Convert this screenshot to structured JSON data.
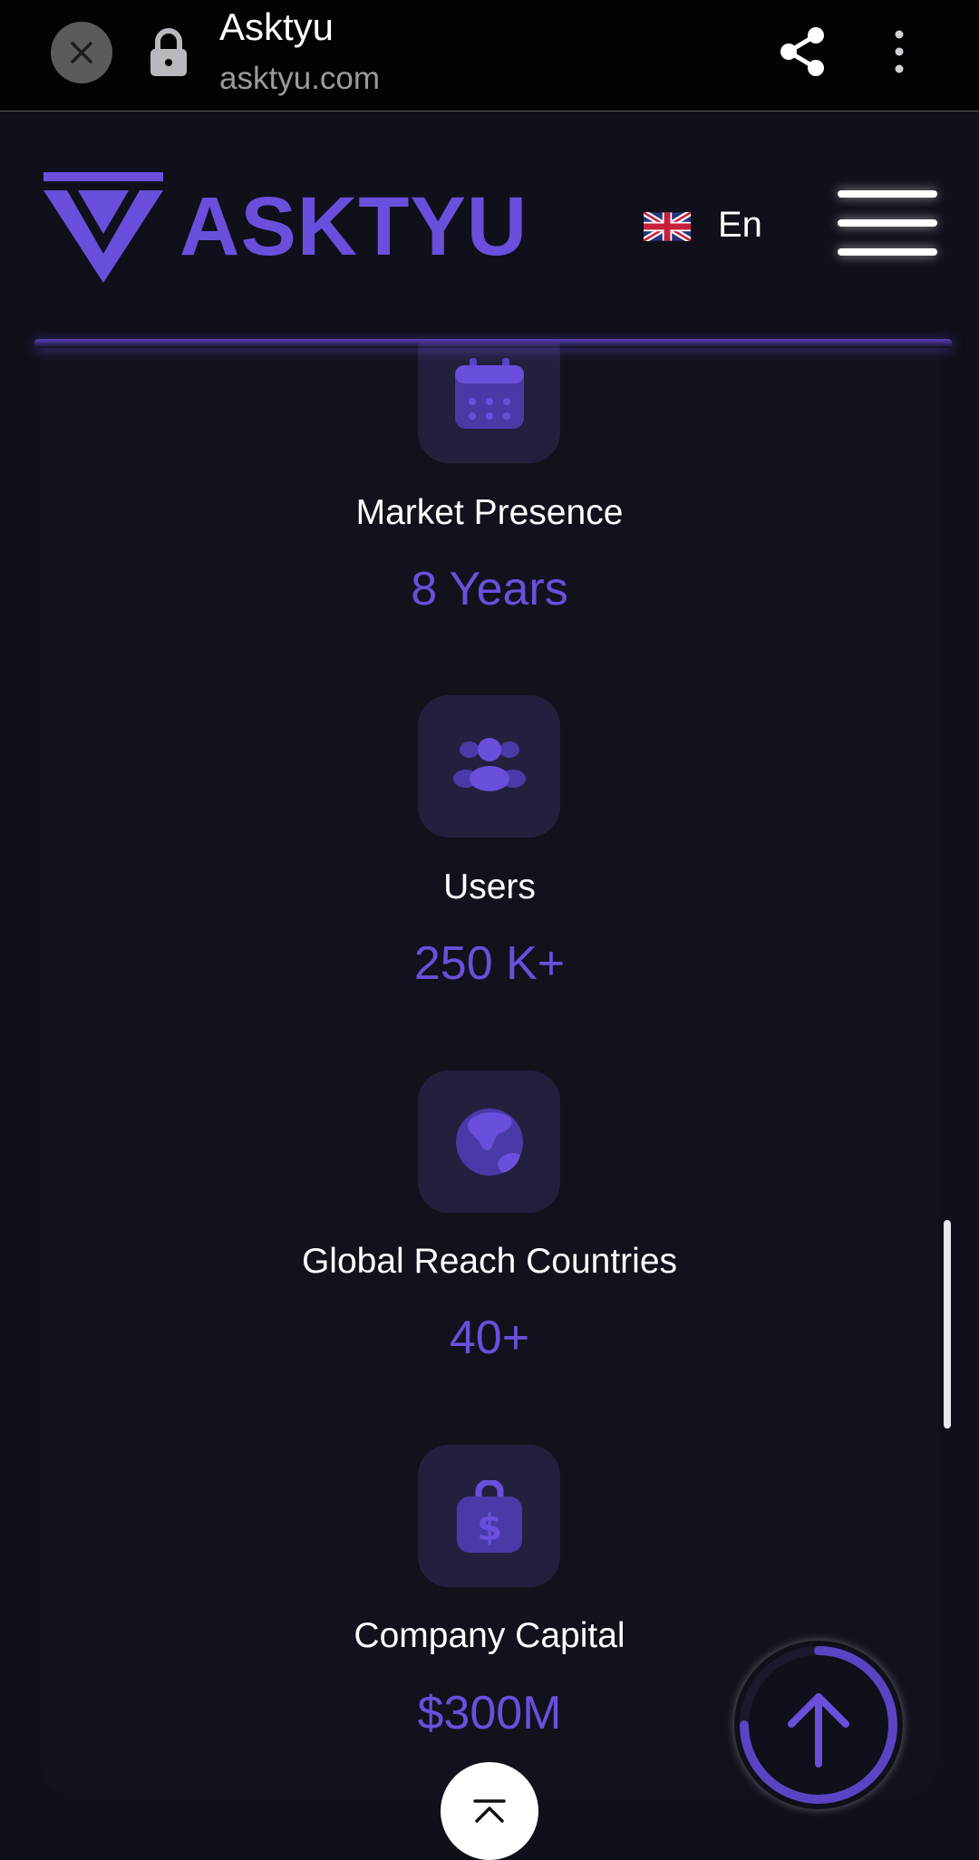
{
  "browser": {
    "title": "Asktyu",
    "url": "asktyu.com"
  },
  "header": {
    "logo_text": "ASKTYU",
    "language": "En"
  },
  "stats": [
    {
      "icon": "calendar-icon",
      "label": "Market Presence",
      "value": "8 Years"
    },
    {
      "icon": "users-icon",
      "label": "Users",
      "value": "250 K+"
    },
    {
      "icon": "globe-icon",
      "label": "Global Reach Countries",
      "value": "40+"
    },
    {
      "icon": "money-bag-icon",
      "label": "Company Capital",
      "value": "$300M"
    }
  ],
  "colors": {
    "accent": "#6a4fdd",
    "background": "#0f1019",
    "tile": "#23203d"
  }
}
